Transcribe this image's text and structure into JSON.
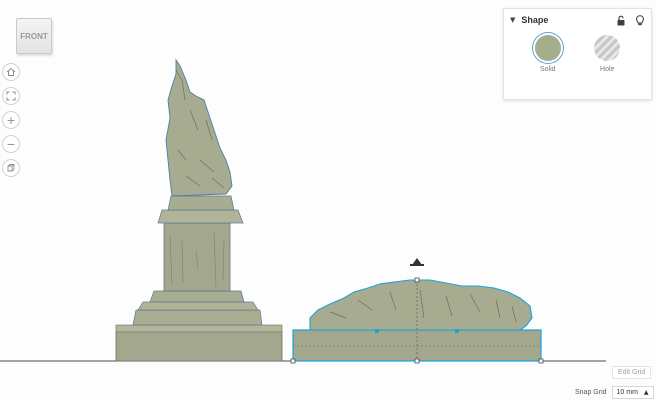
{
  "view_cube": {
    "label": "FRONT"
  },
  "nav": [
    {
      "name": "home-view-button",
      "icon": "home-icon"
    },
    {
      "name": "fit-view-button",
      "icon": "fit-view-icon"
    },
    {
      "name": "zoom-in-button",
      "icon": "zoom-in-icon",
      "glyph": "+"
    },
    {
      "name": "zoom-out-button",
      "icon": "zoom-out-icon",
      "glyph": "−"
    },
    {
      "name": "ortho-view-button",
      "icon": "cube-icon"
    }
  ],
  "shape_panel": {
    "title": "Shape",
    "collapse_glyph": "▼",
    "lock_icon": "lock-icon",
    "light_icon": "lightbulb-icon",
    "options": [
      {
        "label": "Solid",
        "selected": true,
        "color": "#a6ad8c"
      },
      {
        "label": "Hole",
        "selected": false
      }
    ]
  },
  "footer": {
    "edit_grid": "Edit Grid",
    "snap_label": "Snap Grid",
    "snap_value": "10 mm",
    "snap_caret": "▲"
  },
  "colors": {
    "model": "#a3a78d",
    "selection": "#1aa3d9",
    "ground": "#4a4a4a"
  }
}
